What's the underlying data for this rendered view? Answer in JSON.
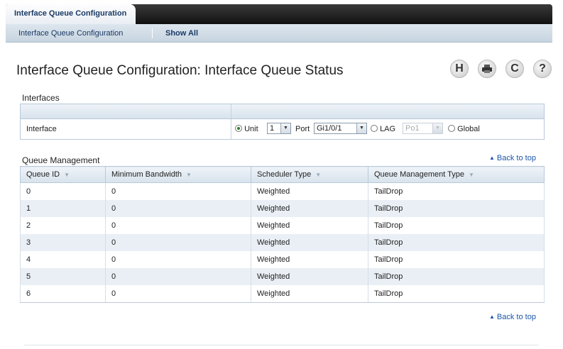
{
  "top_tab": "Interface Queue Configuration",
  "subnav": [
    "Interface Queue Configuration",
    "Show All"
  ],
  "page_title": "Interface Queue Configuration: Interface Queue Status",
  "toolbar": {
    "save_icon": "H",
    "print_icon": "print-icon",
    "refresh_icon": "C",
    "help_icon": "?"
  },
  "interfaces": {
    "section_label": "Interfaces",
    "row_label": "Interface",
    "unit_label": "Unit",
    "unit_value": "1",
    "port_label": "Port",
    "port_value": "Gi1/0/1",
    "lag_label": "LAG",
    "lag_value": "Po1",
    "global_label": "Global",
    "selected": "Unit"
  },
  "queue_management": {
    "section_label": "Queue Management",
    "back_to_top": "Back to top",
    "columns": [
      "Queue ID",
      "Minimum Bandwidth",
      "Scheduler Type",
      "Queue Management Type"
    ],
    "rows": [
      [
        "0",
        "0",
        "Weighted",
        "TailDrop"
      ],
      [
        "1",
        "0",
        "Weighted",
        "TailDrop"
      ],
      [
        "2",
        "0",
        "Weighted",
        "TailDrop"
      ],
      [
        "3",
        "0",
        "Weighted",
        "TailDrop"
      ],
      [
        "4",
        "0",
        "Weighted",
        "TailDrop"
      ],
      [
        "5",
        "0",
        "Weighted",
        "TailDrop"
      ],
      [
        "6",
        "0",
        "Weighted",
        "TailDrop"
      ]
    ]
  },
  "bottom_back_to_top": "Back to top"
}
